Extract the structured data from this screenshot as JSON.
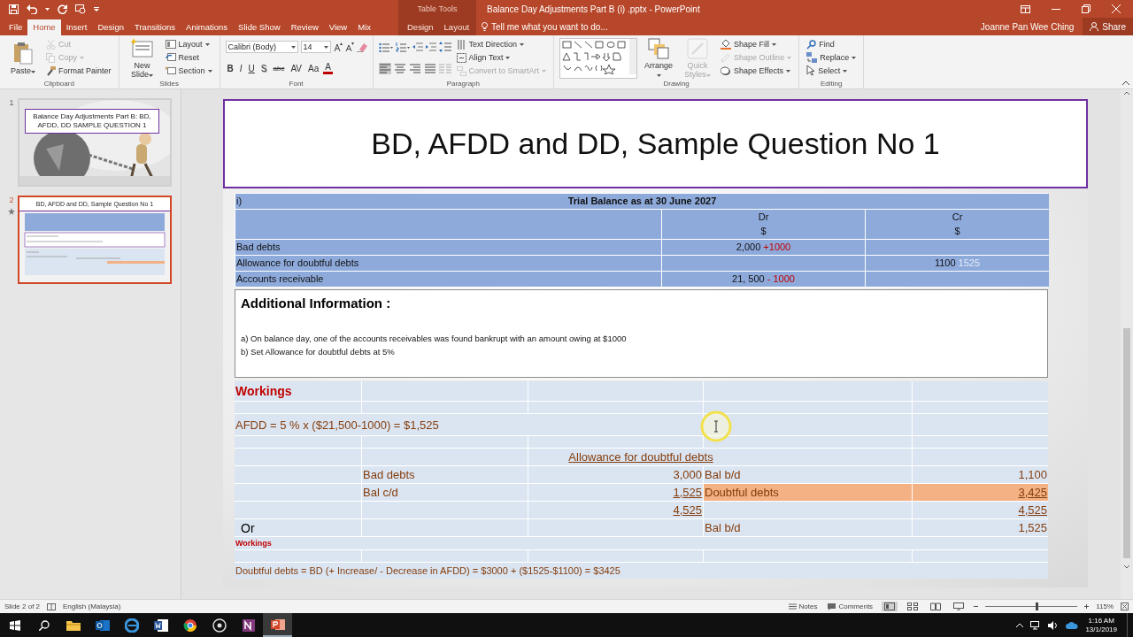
{
  "title_bar": {
    "context_label": "Table Tools",
    "title": "Balance Day Adjustments Part B  (i) .pptx - PowerPoint"
  },
  "menu_tabs": [
    {
      "label": "File",
      "selected": false,
      "contextual": false
    },
    {
      "label": "Home",
      "selected": true,
      "contextual": false
    },
    {
      "label": "Insert",
      "selected": false,
      "contextual": false
    },
    {
      "label": "Design",
      "selected": false,
      "contextual": false
    },
    {
      "label": "Transitions",
      "selected": false,
      "contextual": false
    },
    {
      "label": "Animations",
      "selected": false,
      "contextual": false
    },
    {
      "label": "Slide Show",
      "selected": false,
      "contextual": false
    },
    {
      "label": "Review",
      "selected": false,
      "contextual": false
    },
    {
      "label": "View",
      "selected": false,
      "contextual": false
    },
    {
      "label": "Mix",
      "selected": false,
      "contextual": false
    },
    {
      "label": "Design",
      "selected": false,
      "contextual": true
    },
    {
      "label": "Layout",
      "selected": false,
      "contextual": true
    }
  ],
  "tell_me": {
    "placeholder": "Tell me what you want to do..."
  },
  "user": "Joanne Pan Wee Ching",
  "share_button": "Share",
  "ribbon": {
    "groups": [
      {
        "label": "Clipboard",
        "kind": "standard",
        "items": [
          {
            "label": "Paste",
            "kind": "large",
            "disabled": false,
            "dropdown": true
          },
          {
            "label": "Cut",
            "kind": "small",
            "disabled": true,
            "dropdown": false
          },
          {
            "label": "Copy",
            "kind": "small",
            "disabled": true,
            "dropdown": true
          },
          {
            "label": "Format Painter",
            "kind": "small",
            "disabled": false,
            "dropdown": false
          }
        ]
      },
      {
        "label": "Slides",
        "kind": "standard",
        "items": [
          {
            "label": "New Slide",
            "kind": "large",
            "disabled": false,
            "dropdown": true
          },
          {
            "label": "Layout",
            "kind": "small",
            "disabled": false,
            "dropdown": true
          },
          {
            "label": "Reset",
            "kind": "small",
            "disabled": false,
            "dropdown": false
          },
          {
            "label": "Section",
            "kind": "small",
            "disabled": false,
            "dropdown": true
          }
        ]
      },
      {
        "label": "Font",
        "kind": "font",
        "font_name": "Calibri (Body)",
        "font_size": "14",
        "format_buttons": [
          "B",
          "I",
          "U",
          "S",
          "abc",
          "AV",
          "Aa",
          "A"
        ]
      },
      {
        "label": "Paragraph",
        "kind": "paragraph",
        "align_buttons": [
          {
            "selected": true
          },
          {
            "selected": false
          },
          {
            "selected": false
          },
          {
            "selected": false
          }
        ],
        "items": [
          {
            "label": "Text Direction",
            "kind": "small",
            "disabled": false,
            "dropdown": true
          },
          {
            "label": "Align Text",
            "kind": "small",
            "disabled": false,
            "dropdown": true
          },
          {
            "label": "Convert to SmartArt",
            "kind": "small",
            "disabled": true,
            "dropdown": true
          }
        ]
      },
      {
        "label": "Drawing",
        "kind": "drawing",
        "items": [
          {
            "label": "Arrange",
            "kind": "large",
            "disabled": false,
            "dropdown": true
          },
          {
            "label": "Quick Styles",
            "kind": "large",
            "disabled": true,
            "dropdown": true
          },
          {
            "label": "Shape Fill",
            "kind": "small",
            "disabled": false,
            "dropdown": true
          },
          {
            "label": "Shape Outline",
            "kind": "small",
            "disabled": true,
            "dropdown": true
          },
          {
            "label": "Shape Effects",
            "kind": "small",
            "disabled": false,
            "dropdown": true
          }
        ]
      },
      {
        "label": "Editing",
        "kind": "standard",
        "items": [
          {
            "label": "Find",
            "kind": "small",
            "disabled": false,
            "dropdown": false
          },
          {
            "label": "Replace",
            "kind": "small",
            "disabled": false,
            "dropdown": true
          },
          {
            "label": "Select",
            "kind": "small",
            "disabled": false,
            "dropdown": true
          }
        ]
      }
    ]
  },
  "thumbnails": [
    {
      "number": "1",
      "title": "Balance Day Adjustments Part B: BD, AFDD, DD SAMPLE QUESTION  1",
      "kind": "title-photo",
      "selected": false,
      "has_animation": false
    },
    {
      "number": "2",
      "title": "BD, AFDD and DD, Sample Question No 1",
      "kind": "table-preview",
      "selected": true,
      "has_animation": true
    }
  ],
  "slide": {
    "title": "BD, AFDD and DD, Sample Question No 1",
    "trial_balance": {
      "label": "i)",
      "heading": "Trial Balance as at 30 June 2027",
      "columns": [
        {
          "name": "Dr",
          "unit": "$"
        },
        {
          "name": "Cr",
          "unit": "$"
        }
      ],
      "rows": [
        {
          "account": "Bad debts",
          "dr": [
            {
              "text": "2,000",
              "kind": "normal"
            },
            {
              "text": "+1000",
              "kind": "adjustment"
            }
          ]
        },
        {
          "account": "Allowance for doubtful debts",
          "cr": [
            {
              "text": "1100",
              "kind": "normal"
            },
            {
              "text": "1525",
              "kind": "faded"
            }
          ]
        },
        {
          "account": "Accounts receivable",
          "dr": [
            {
              "text": "21, 500",
              "kind": "normal"
            },
            {
              "text": "- 1000",
              "kind": "adjustment"
            }
          ]
        }
      ]
    },
    "additional_info": {
      "heading": "Additional Information :",
      "lines": [
        "a) On balance day, one of the accounts receivables was found bankrupt with an amount owing at $1000",
        "b)  Set Allowance for doubtful debts at 5%"
      ]
    },
    "workings": {
      "heading": "Workings",
      "formula": "AFDD = 5 % x ($21,500-1000) = $1,525",
      "ledger_title": "Allowance for doubtful debts",
      "ledger_rows": [
        {
          "debit_label": "Bad debts",
          "debit_amount": "3,000",
          "debit_underlined": false,
          "credit_label": "Bal b/d",
          "credit_amount": "1,100",
          "credit_underlined": false,
          "highlighted": false
        },
        {
          "debit_label": "Bal c/d",
          "debit_amount": "1,525",
          "debit_underlined": true,
          "credit_label": "Doubtful debts",
          "credit_amount": "3,425",
          "credit_underlined": true,
          "highlighted": true
        },
        {
          "debit_amount": "4,525",
          "debit_underlined": true,
          "credit_amount": "4,525",
          "credit_underlined": true,
          "highlighted": false
        },
        {
          "note": "Or",
          "credit_label": "Bal b/d",
          "credit_amount": "1,525",
          "credit_underlined": false,
          "highlighted": false
        }
      ],
      "sub_heading": "Workings",
      "explanation": "Doubtful debts =  BD (+ Increase/ -  Decrease in AFDD) = $3000 +  ($1525-$1100) = $3425"
    }
  },
  "status_bar": {
    "slide_indicator": "Slide 2 of 2",
    "language": "English (Malaysia)",
    "notes_button": "Notes",
    "comments_button": "Comments",
    "views": [
      {
        "kind": "normal",
        "selected": true
      },
      {
        "kind": "sorter",
        "selected": false
      },
      {
        "kind": "reading",
        "selected": false
      },
      {
        "kind": "slideshow",
        "selected": false
      }
    ],
    "zoom": {
      "level": 0.55,
      "reading": "115%"
    }
  },
  "taskbar": {
    "apps": [
      {
        "kind": "folder",
        "selected": false
      },
      {
        "kind": "mail",
        "selected": false
      },
      {
        "kind": "browser",
        "selected": false
      },
      {
        "kind": "document",
        "selected": false
      },
      {
        "kind": "round-browser",
        "selected": false
      },
      {
        "kind": "recorder",
        "selected": false
      },
      {
        "kind": "notebook",
        "selected": false
      },
      {
        "kind": "presentation",
        "selected": true
      }
    ],
    "time": "1:16 AM",
    "date": "13/1/2019"
  }
}
